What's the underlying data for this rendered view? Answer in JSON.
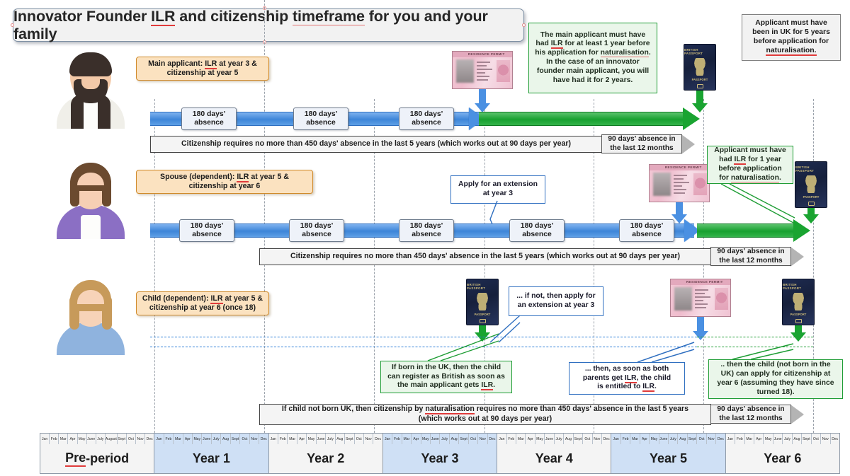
{
  "title": {
    "part1": "Innovator Founder ",
    "ilr": "ILR",
    "part2": " and citizenship ",
    "timeframe": "timeframe",
    "part3": " for you and your family"
  },
  "callouts": {
    "main_applicant_green": "The main applicant must have had ILR for at least 1 year before his application for naturalisation. In the case of an innovator founder main applicant, you will have had it for 2 years.",
    "main_applicant_green_lines": [
      "The main applicant must have",
      "had ILR for at least 1 year before",
      "his application for naturalisation.",
      "In the case of an innovator",
      "founder main applicant, you will",
      "have had it for 2 years."
    ],
    "top_right_grey_lines": [
      "Applicant must have",
      "been in UK for 5 years",
      "before application for",
      "naturalisation."
    ],
    "spouse_green_lines": [
      "Applicant must have",
      "had ILR for 1 year",
      "before application",
      "for naturalisation."
    ],
    "apply_extension_lines": [
      "Apply for an extension",
      "at year 3"
    ],
    "child_extension_lines": [
      "... if not, then apply for",
      "an extension at year 3"
    ],
    "child_born_uk_lines": [
      "If born in the UK, then the child",
      "can register as British as soon as",
      "the main applicant gets ILR."
    ],
    "child_both_parents_lines": [
      "... then, as soon as both",
      "parents get ILR, the child",
      "is entitled to ILR."
    ],
    "child_not_born_uk_lines": [
      ".. then the child (not born in the",
      "UK) can apply for citizenship at",
      "year 6 (assuming they have since",
      "turned 18)."
    ]
  },
  "person_labels": {
    "main": [
      "Main applicant: ILR at year 3 &",
      "citizenship at year 5"
    ],
    "spouse": [
      "Spouse (dependent): ILR at year 5 &",
      "citizenship at year 6"
    ],
    "child": [
      "Child (dependent): ILR at year 5 &",
      "citizenship at year 6 (once 18)"
    ]
  },
  "absence_chip": [
    "180 days'",
    "absence"
  ],
  "banners": {
    "citizenship_450": "Citizenship requires no more than 450 days' absence in the last 5 years (which works out at 90 days per year)",
    "child_450_lines": [
      "If child not born UK, then citizenship by naturalisation requires no more than 450 days' absence in the last 5 years",
      "(which works out at 90 days per year)"
    ],
    "ninety_days_lines": [
      "90 days' absence in",
      "the last 12 months"
    ]
  },
  "timeline": {
    "months": [
      "Jan",
      "Feb",
      "Mar",
      "Apr",
      "May",
      "June",
      "July",
      "August",
      "Sept",
      "Oct",
      "Nov",
      "Dec"
    ],
    "months_short": [
      "Jan",
      "Feb",
      "Mar",
      "Apr",
      "May",
      "June",
      "July",
      "Aug",
      "Sept",
      "Oct",
      "Nov",
      "Dec"
    ],
    "columns": [
      {
        "label": "Pre-period",
        "shade": "grey",
        "underline": true
      },
      {
        "label": "Year 1",
        "shade": "blue",
        "underline": false
      },
      {
        "label": "Year 2",
        "shade": "grey",
        "underline": false
      },
      {
        "label": "Year 3",
        "shade": "blue",
        "underline": false
      },
      {
        "label": "Year 4",
        "shade": "grey",
        "underline": false
      },
      {
        "label": "Year 5",
        "shade": "blue",
        "underline": false
      },
      {
        "label": "Year 6",
        "shade": "grey",
        "underline": false
      }
    ]
  },
  "documents": {
    "brp_title": "RESIDENCE PERMIT",
    "passport_top": "BRITISH PASSPORT",
    "passport_bottom": "PASSPORT"
  },
  "colors": {
    "blue": "#4a90e2",
    "green": "#1aa431",
    "orange_fill": "#fbe2c0",
    "orange_border": "#d08a2a",
    "grey_panel": "#f2f2f2",
    "red_underline": "#e03b3b"
  }
}
